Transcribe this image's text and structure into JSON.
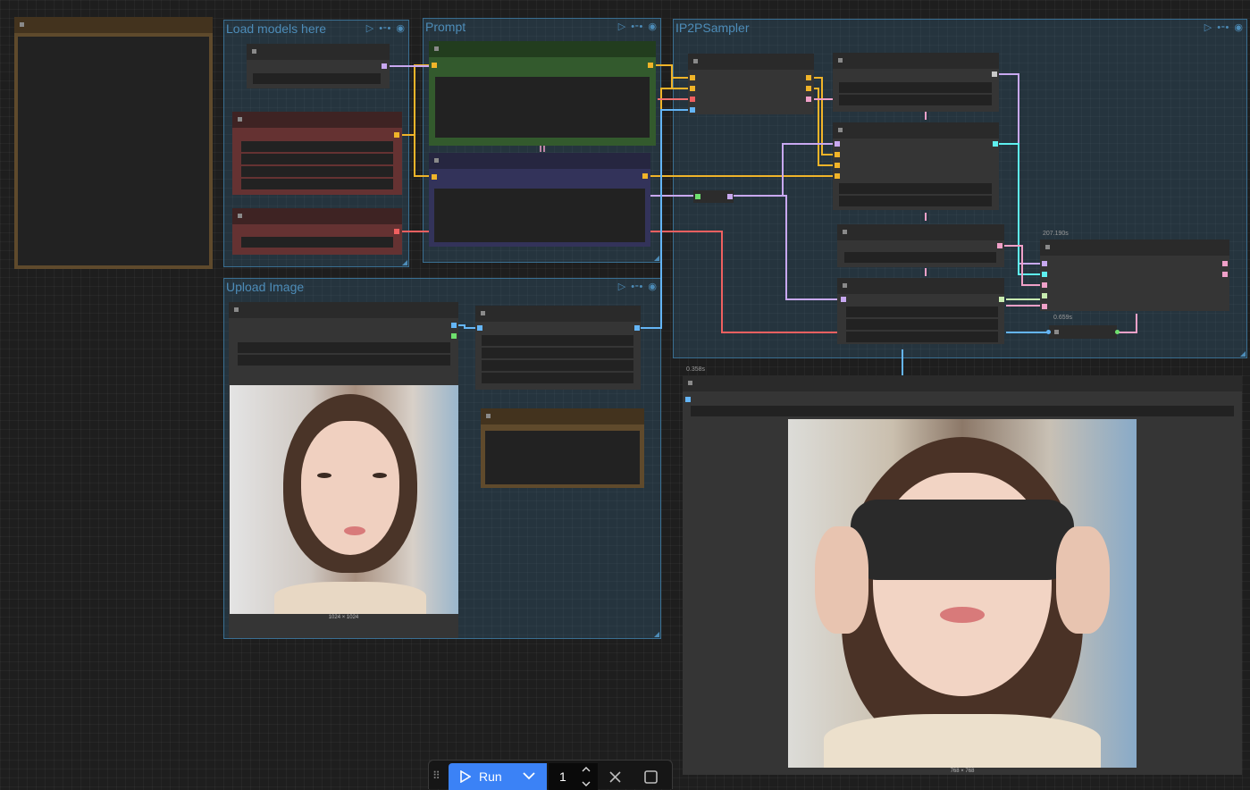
{
  "groups": {
    "load_models": {
      "title": "Load models here"
    },
    "prompt": {
      "title": "Prompt"
    },
    "sampler": {
      "title": "IP2PSampler"
    },
    "upload": {
      "title": "Upload Image"
    }
  },
  "group_icons": [
    "play-icon",
    "bypass-icon",
    "eye-icon"
  ],
  "timings": {
    "sampler_node": "207.190s",
    "small_node": "0.659s",
    "preview_node": "0.358s"
  },
  "images": {
    "input_caption": "1024 × 1024",
    "output_caption": "768 × 768"
  },
  "toolbar": {
    "run_label": "Run",
    "batch_count": "1"
  },
  "colors": {
    "accent": "#3b82f6",
    "group_border": "#3a6f92",
    "wire_yellow": "#f0b429",
    "wire_lavender": "#c8a8f0",
    "wire_cyan": "#5ef0f0",
    "wire_red": "#f06060",
    "wire_pink": "#f0a0c8",
    "wire_blue": "#64b5f6"
  }
}
